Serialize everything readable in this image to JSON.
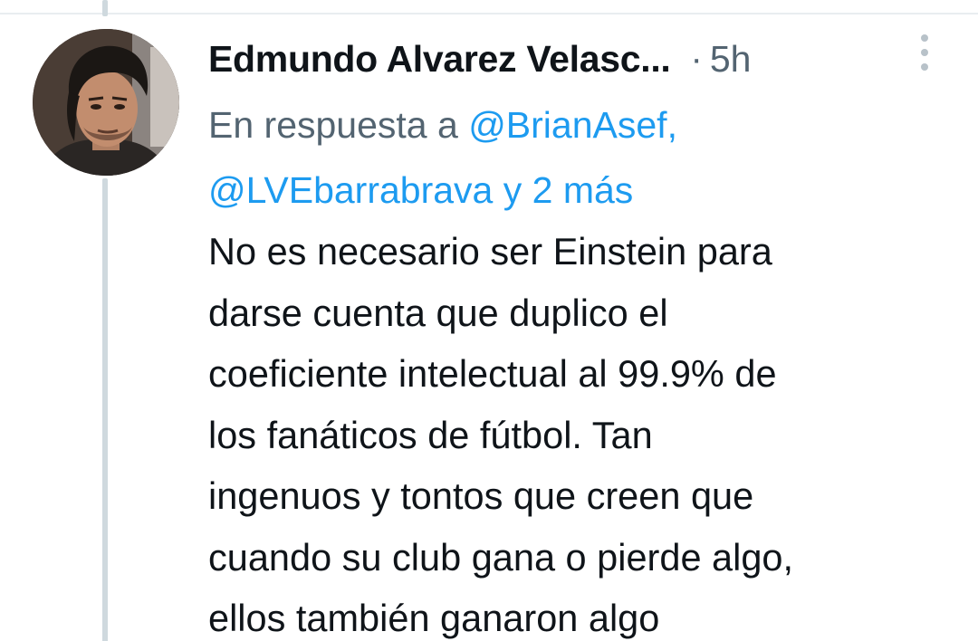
{
  "tweet": {
    "author_name": "Edmundo Alvarez Velasc...",
    "separator": "·",
    "timestamp": "5h",
    "reply_prefix": "En respuesta a ",
    "mention_1": "@BrianAsef",
    "mention_1_punct": ",",
    "mention_2": "@LVEbarrabrava",
    "mention_joiner": " y ",
    "mention_more": "2 más",
    "text": "No es necesario ser Einstein para\ndarse cuenta que duplico el\ncoeficiente intelectual al 99.9% de\nlos fanáticos de fútbol. Tan\ningenuos y tontos que creen que\ncuando su club gana o pierde algo,\nellos también ganaron algo"
  },
  "icons": {
    "more": "more-vertical-icon"
  },
  "colors": {
    "link": "#1d9bf0",
    "secondary_text": "#536471",
    "primary_text": "#0f1419",
    "thread_line": "#cfd9de"
  }
}
